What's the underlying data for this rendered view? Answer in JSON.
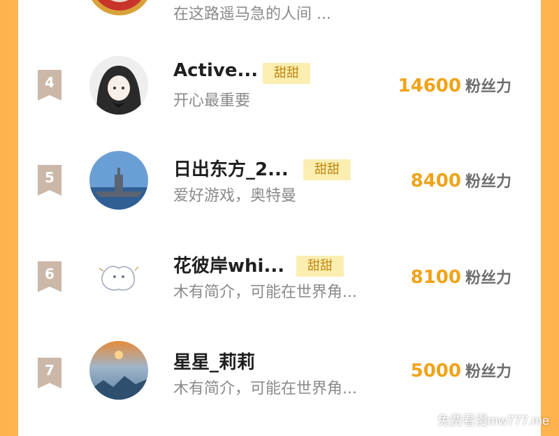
{
  "top_partial": {
    "bio": "在这路遥马急的人间 ..."
  },
  "unit_label": "粉丝力",
  "rows": [
    {
      "rank": "4",
      "name": "Active...",
      "tag": "甜甜",
      "bio": "开心最重要",
      "score": "14600"
    },
    {
      "rank": "5",
      "name": "日出东方_2...",
      "tag": "甜甜",
      "bio": "爱好游戏，奥特曼",
      "score": "8400"
    },
    {
      "rank": "6",
      "name": "花彼岸whi...",
      "tag": "甜甜",
      "bio": "木有简介，可能在世界角...",
      "score": "8100"
    },
    {
      "rank": "7",
      "name": "星星_莉莉",
      "tag": "",
      "bio": "木有简介，可能在世界角...",
      "score": "5000"
    }
  ],
  "watermark": "免费看漫mw777.me",
  "colors": {
    "background": "#ffb24d",
    "score": "#f0a319",
    "tag_bg": "#fbeeb0",
    "tag_text": "#c08610",
    "rank_badge": "#cbb8a8"
  }
}
